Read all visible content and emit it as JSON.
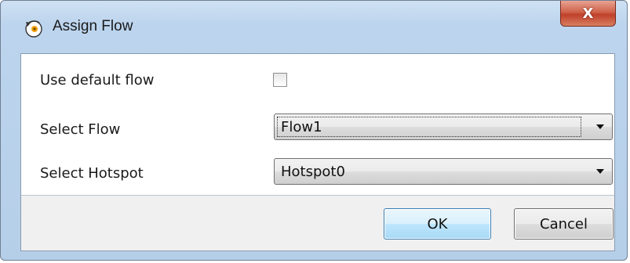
{
  "window": {
    "title": "Assign Flow",
    "close_glyph": "X",
    "app_icon": "assign-flow-icon"
  },
  "form": {
    "use_default_flow": {
      "label": "Use default flow",
      "checked": false
    },
    "select_flow": {
      "label": "Select Flow",
      "value": "Flow1"
    },
    "select_hotspot": {
      "label": "Select Hotspot",
      "value": "Hotspot0"
    }
  },
  "buttons": {
    "ok_label": "OK",
    "cancel_label": "Cancel"
  },
  "colors": {
    "frame": "#b6cfe9",
    "close": "#c0402a",
    "ok_border": "#3c7fb1"
  }
}
